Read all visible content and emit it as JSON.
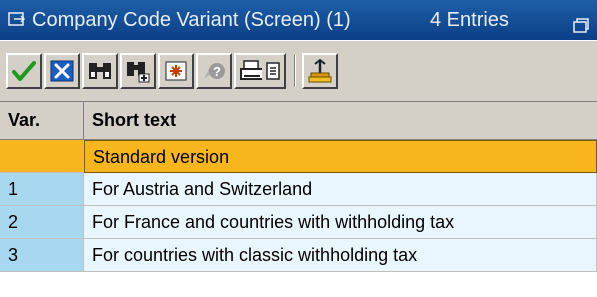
{
  "window": {
    "title": "Company Code Variant (Screen) (1)",
    "entries_label": "4 Entries"
  },
  "toolbar": {
    "buttons": [
      {
        "icon": "checkmark-icon",
        "color": "#1f9a1f"
      },
      {
        "icon": "cancel-x-icon",
        "color": "#1a5fc0"
      },
      {
        "icon": "binoculars-find-icon",
        "color": "#000000"
      },
      {
        "icon": "binoculars-find-next-icon",
        "color": "#000000"
      },
      {
        "icon": "new-entries-icon",
        "color": "#c04000"
      },
      {
        "icon": "help-icon",
        "color": "#7a7a7a"
      },
      {
        "icon": "print-icon",
        "color": "#000000"
      },
      {
        "icon": "list-icon",
        "color": "#000000"
      },
      {
        "icon": "sort-icon",
        "color": "#b08000"
      }
    ]
  },
  "table": {
    "columns": [
      "Var.",
      "Short text"
    ],
    "rows": [
      {
        "var": "",
        "text": "Standard version",
        "selected": true
      },
      {
        "var": "1",
        "text": "For Austria and Switzerland",
        "selected": false
      },
      {
        "var": "2",
        "text": "For France and countries with withholding tax",
        "selected": false
      },
      {
        "var": "3",
        "text": "For countries with classic withholding tax",
        "selected": false
      }
    ]
  },
  "colors": {
    "titlebar": "#0b3f86",
    "selected_row": "#f7b51e",
    "key_cell": "#a8d8f0",
    "text_cell": "#eaf6fd"
  }
}
